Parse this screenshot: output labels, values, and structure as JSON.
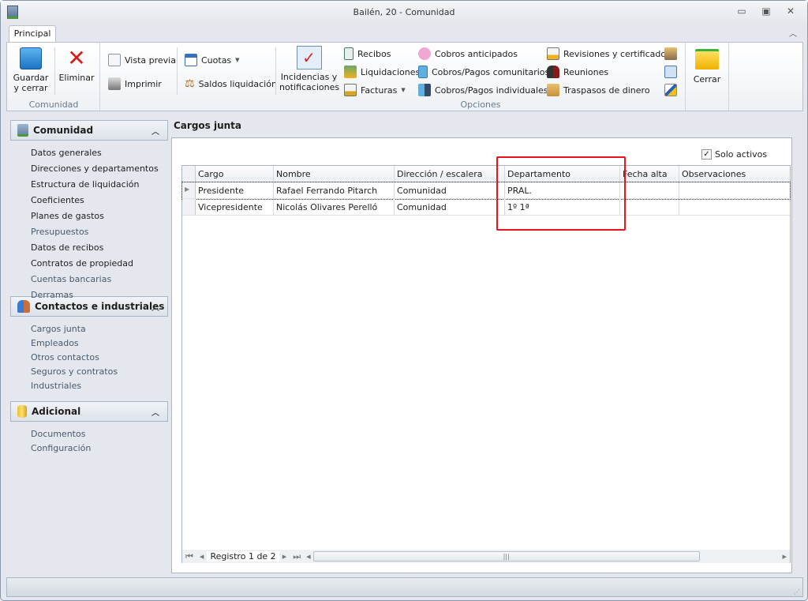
{
  "window": {
    "title": "Bailén, 20 - Comunidad",
    "minimize": "▭",
    "restore": "▣",
    "close": "✕",
    "collapse_ribbon": "︿"
  },
  "ribbon": {
    "tab": "Principal",
    "groups": {
      "comunidad": "Comunidad",
      "opciones": "Opciones"
    },
    "guardar": "Guardar\ny cerrar",
    "eliminar": "Eliminar",
    "vista_previa": "Vista previa",
    "imprimir": "Imprimir",
    "cuotas": "Cuotas",
    "saldos": "Saldos liquidación",
    "incidencias": "Incidencias y\nnotificaciones",
    "recibos": "Recibos",
    "liquidaciones": "Liquidaciones",
    "facturas": "Facturas",
    "cobros_anticipados": "Cobros anticipados",
    "cobros_comunitarios": "Cobros/Pagos comunitarios",
    "cobros_individuales": "Cobros/Pagos individuales",
    "revisiones": "Revisiones y certificados",
    "reuniones": "Reuniones",
    "traspasos": "Traspasos de dinero",
    "cerrar": "Cerrar"
  },
  "sidebar": {
    "sections": [
      {
        "title": "Comunidad",
        "items": [
          {
            "label": "Datos generales",
            "muted": false
          },
          {
            "label": "Direcciones y departamentos",
            "muted": false
          },
          {
            "label": "Estructura de liquidación",
            "muted": false
          },
          {
            "label": "Coeficientes",
            "muted": false
          },
          {
            "label": "Planes de gastos",
            "muted": false
          },
          {
            "label": "Presupuestos",
            "muted": true
          },
          {
            "label": "Datos de recibos",
            "muted": false
          },
          {
            "label": "Contratos de propiedad",
            "muted": false
          },
          {
            "label": "Cuentas bancarias",
            "muted": true
          },
          {
            "label": "Derramas",
            "muted": true
          }
        ]
      },
      {
        "title": "Contactos e industriales",
        "items": [
          {
            "label": "Cargos junta",
            "muted": true
          },
          {
            "label": "Empleados",
            "muted": true
          },
          {
            "label": "Otros contactos",
            "muted": true
          },
          {
            "label": "Seguros y contratos",
            "muted": true
          },
          {
            "label": "Industriales",
            "muted": true
          }
        ]
      },
      {
        "title": "Adicional",
        "items": [
          {
            "label": "Documentos",
            "muted": true
          },
          {
            "label": "Configuración",
            "muted": true
          }
        ]
      }
    ]
  },
  "content": {
    "title": "Cargos junta",
    "solo_activos": "Solo activos",
    "solo_activos_checked": true,
    "columns": [
      "Cargo",
      "Nombre",
      "Dirección / escalera",
      "Departamento",
      "Fecha alta",
      "Observaciones"
    ],
    "rows": [
      [
        "Presidente",
        "Rafael Ferrando Pitarch",
        "Comunidad",
        "PRAL.",
        "",
        ""
      ],
      [
        "Vicepresidente",
        "Nicolás Olivares Perelló",
        "Comunidad",
        "1º 1ª",
        "",
        ""
      ]
    ],
    "navigator": "Registro 1 de 2"
  },
  "colors": {
    "highlight": "#e8141c"
  }
}
